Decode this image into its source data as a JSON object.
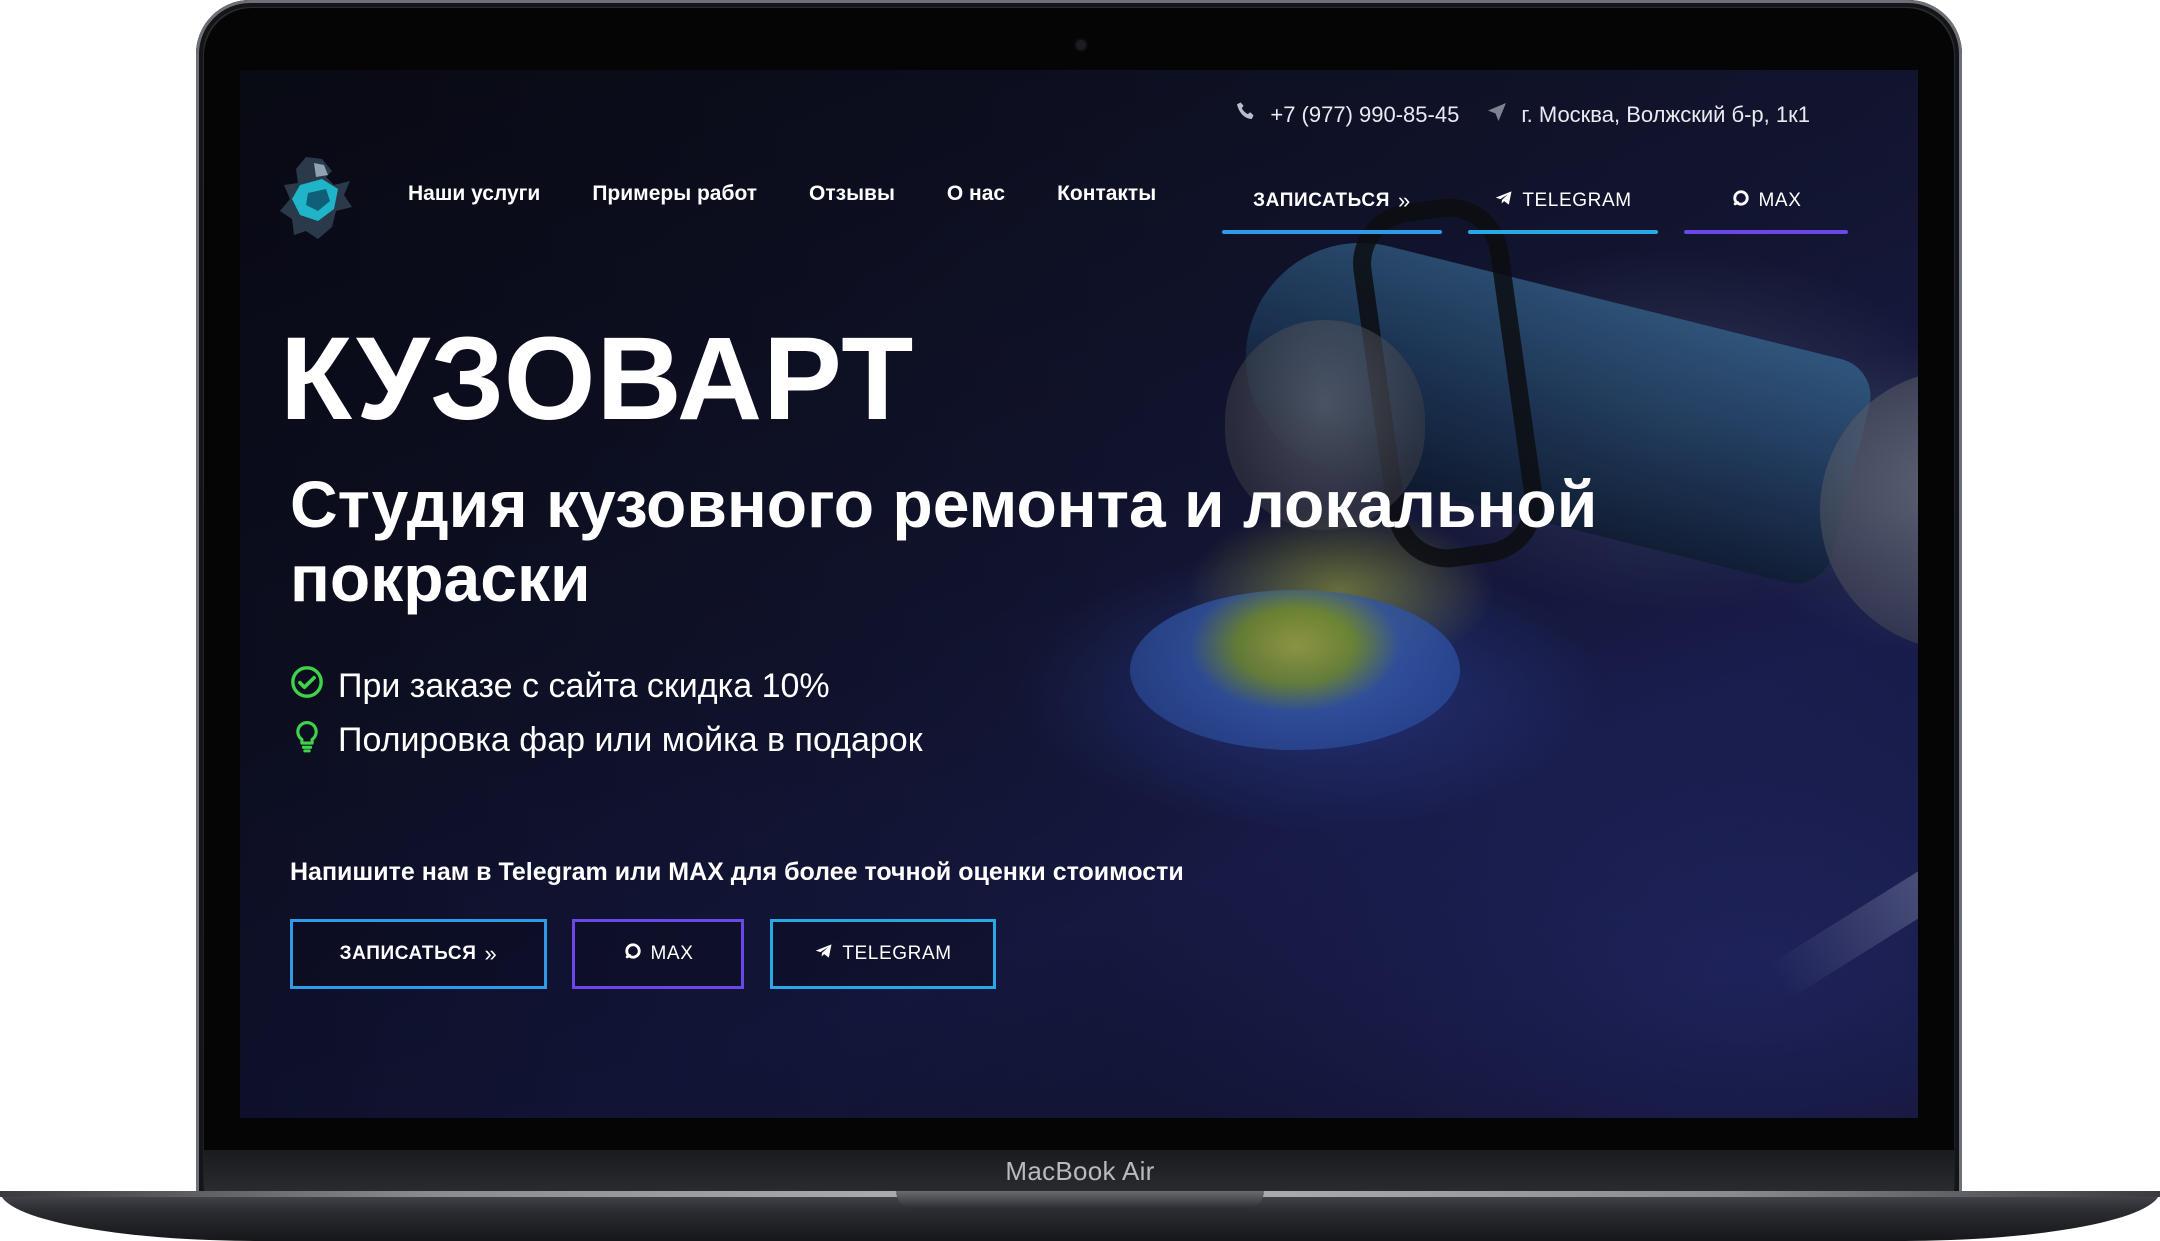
{
  "device": {
    "label": "MacBook Air"
  },
  "contacts": {
    "phone": "+7 (977) 990-85-45",
    "address": "г. Москва, Волжский б-р, 1к1"
  },
  "nav": {
    "items": [
      {
        "label": "Наши услуги"
      },
      {
        "label": "Примеры работ"
      },
      {
        "label": "Отзывы"
      },
      {
        "label": "О нас"
      },
      {
        "label": "Контакты"
      }
    ],
    "signup_label": "ЗАПИСАТЬСЯ",
    "telegram_label": "TELEGRAM",
    "max_label": "MAX"
  },
  "hero": {
    "brand": "КУЗОВАРТ",
    "title": "Студия кузовного ремонта и локальной покраски",
    "features": [
      {
        "text": "При заказе с сайта скидка 10%",
        "icon": "check-circle-icon",
        "color": "#3fd24a"
      },
      {
        "text": "Полировка фар или мойка в подарок",
        "icon": "lightbulb-icon",
        "color": "#3fd24a"
      }
    ],
    "note": "Напишите нам в Telegram или MAX для более точной оценки стоимости",
    "cta_signup": "ЗАПИСАТЬСЯ",
    "cta_max": "MAX",
    "cta_telegram": "TELEGRAM"
  },
  "colors": {
    "signup_accent": "#2f9be8",
    "telegram_accent": "#2aa7e6",
    "max_accent": "#6a47e6"
  }
}
